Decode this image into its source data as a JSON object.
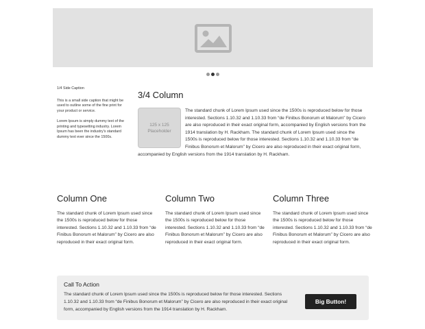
{
  "side": {
    "caption": "1/4 Side Caption",
    "text1": "This is a small side caption that might be used to outline some of the fine print for your product or service.",
    "text2": "Lorem Ipsum is simply dummy text of the printing and typesetting industry. Lorem Ipsum has been the industry's standard dummy text ever since the 1500s."
  },
  "main": {
    "title": "3/4 Column",
    "placeholder_line1": "125 x 125",
    "placeholder_line2": "Placeholder",
    "body": "The standard chunk of Lorem Ipsum used since the 1500s is reproduced below for those interested. Sections 1.10.32 and 1.10.33 from “de Finibus Bonorum et Malorum” by Cicero are also reproduced in their exact original form, accompanied by English versions from the 1914 translation by H. Rackham. The standard chunk of Lorem Ipsum used since the 1500s is reproduced below for those interested. Sections 1.10.32 and 1.10.33 from “de Finibus Bonorum et Malorum” by Cicero are also reproduced in their exact original form, accompanied by English versions from the 1914 translation by H. Rackham."
  },
  "columns": [
    {
      "title": "Column One",
      "text": "The standard chunk of Lorem Ipsum used since the 1500s is reproduced below for those interested. Sections 1.10.32 and 1.10.33 from “de Finibus Bonorum et Malorum” by Cicero are also reproduced in their exact original form."
    },
    {
      "title": "Column Two",
      "text": "The standard chunk of Lorem Ipsum used since the 1500s is reproduced below for those interested. Sections 1.10.32 and 1.10.33 from “de Finibus Bonorum et Malorum” by Cicero are also reproduced in their exact original form."
    },
    {
      "title": "Column Three",
      "text": "The standard chunk of Lorem Ipsum used since the 1500s is reproduced below for those interested. Sections 1.10.32 and 1.10.33 from “de Finibus Bonorum et Malorum” by Cicero are also reproduced in their exact original form."
    }
  ],
  "cta": {
    "title": "Call To Action",
    "text": "The standard chunk of Lorem Ipsum used since the 1500s is reproduced below for those interested. Sections 1.10.32 and 1.10.33 from “de Finibus Bonorum et Malorum” by Cicero are also reproduced in their exact original form, accompanied by English versions from the 1914 translation by H. Rackham.",
    "button_label": "Big Button!"
  },
  "slider": {
    "active_index": 1,
    "count": 3,
    "icon": "image-icon"
  },
  "colors": {
    "hero_bg": "#e2e2e2",
    "button_bg": "#222222",
    "cta_bg": "#eeeeee"
  }
}
